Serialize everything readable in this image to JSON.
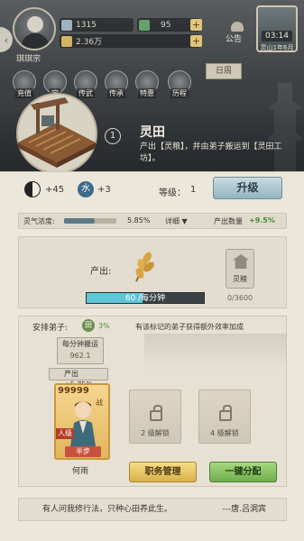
{
  "header": {
    "sect_name": "琪琪宗",
    "stone_value": "1315",
    "jade_value": "95",
    "money_value": "2.36万",
    "announce_label": "公告",
    "date_time": "03:14",
    "date_text": "灵山1年6月",
    "flag_label": "日周"
  },
  "nav": [
    {
      "label": "充值"
    },
    {
      "label": "宝"
    },
    {
      "label": "传武"
    },
    {
      "label": "传承"
    },
    {
      "label": "特惠"
    },
    {
      "label": "历程"
    }
  ],
  "building": {
    "level_badge": "1",
    "title": "灵田",
    "desc": "产出【灵粮】，并由弟子搬运到【灵田工坊】。"
  },
  "stats": {
    "yin_yang": "+45",
    "water_label": "水",
    "water_value": "+3",
    "level_label": "等级：",
    "level_value": "1",
    "upgrade_label": "升级"
  },
  "concentration": {
    "label": "灵气浓度:",
    "fill": 0.58,
    "percent": "5.85%",
    "detail": "详细 ▼",
    "output_label": "产出数量",
    "output_value": "+9.5%"
  },
  "production": {
    "label": "产出:",
    "progress_fill": 0.48,
    "progress_text": "60 /每分钟",
    "store_label": "灵粮",
    "store_count": "0/3600"
  },
  "disciples": {
    "arrange_label": "安排弟子:",
    "badge": "田",
    "bonus_pct": "3%",
    "hint": "有该标记的弟子获得额外效率加成",
    "tag_title": "每分钟搬运",
    "tag_value": "962.1",
    "output_tag": "产出+5.75%",
    "card_stars": "99999",
    "card_rank": "人级",
    "card_state": "半步",
    "card_side": "战",
    "disciple_name": "何雨",
    "slot1": "2 级解锁",
    "slot2": "4 级解锁",
    "btn_manage": "职务管理",
    "btn_assign": "一键分配"
  },
  "quote": {
    "text": "有人问我修行法，只种心田养此生。",
    "author": "---唐.吕洞宾"
  },
  "colors": {
    "upgrade": "#94b4c0",
    "progress": "#5fc6d8",
    "assign": "#6fae4f",
    "manage": "#d8b24d"
  }
}
